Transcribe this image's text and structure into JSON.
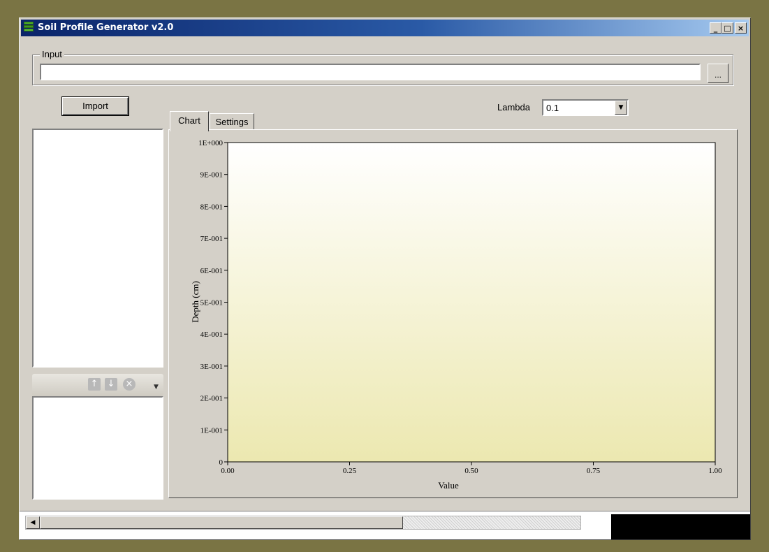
{
  "window": {
    "title": "Soil Profile Generator v2.0",
    "controls": {
      "minimize": "_",
      "maximize": "□",
      "close": "×"
    }
  },
  "input_group": {
    "legend": "Input",
    "value": "",
    "browse_label": "..."
  },
  "import_button": "Import",
  "tabs": [
    {
      "label": "Chart",
      "active": true
    },
    {
      "label": "Settings",
      "active": false
    }
  ],
  "lambda": {
    "label": "Lambda",
    "value": "0.1"
  },
  "list_toolbar": {
    "icons": [
      "arrow-up-icon",
      "arrow-down-icon",
      "remove-icon",
      "overflow-chevron-icon"
    ]
  },
  "colors": {
    "title_start": "#0a246a",
    "title_end": "#a6caf0",
    "plot_top": "#ffffff",
    "plot_bottom": "#ece8b0"
  },
  "chart_data": {
    "type": "line",
    "title": "",
    "xlabel": "Value",
    "ylabel": "Depth (cm)",
    "xlim": [
      0,
      1
    ],
    "ylim": [
      0,
      1
    ],
    "x_ticks": [
      "0.00",
      "0.25",
      "0.50",
      "0.75",
      "1.00"
    ],
    "y_ticks": [
      "0",
      "1E-001",
      "2E-001",
      "3E-001",
      "4E-001",
      "5E-001",
      "6E-001",
      "7E-001",
      "8E-001",
      "9E-001",
      "1E+000"
    ],
    "series": [],
    "grid": false
  }
}
